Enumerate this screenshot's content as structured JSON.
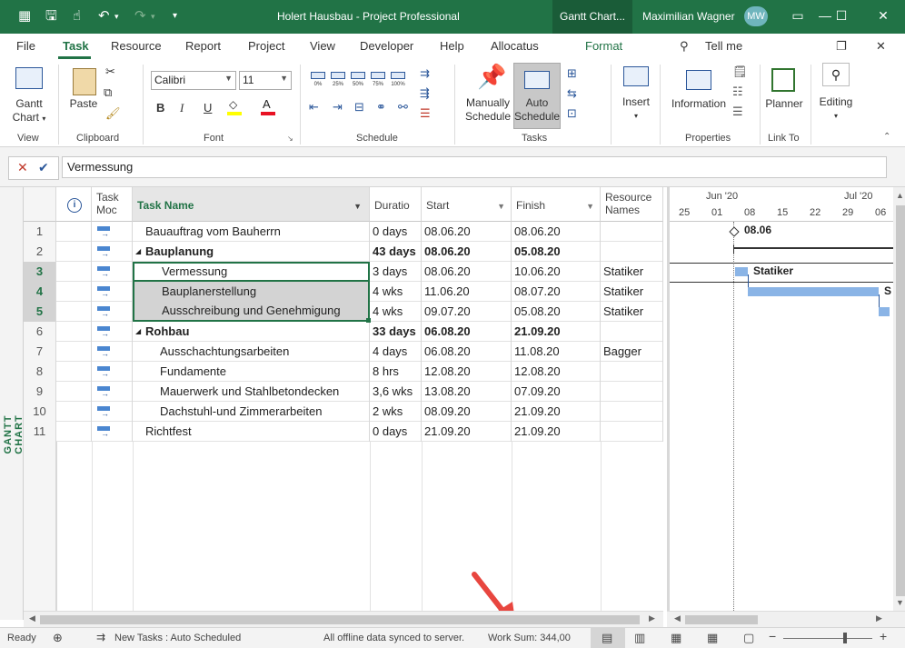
{
  "window": {
    "title": "Holert Hausbau  -  Project Professional",
    "context_tab": "Gantt Chart...",
    "user": "Maximilian Wagner",
    "avatar_initials": "MW"
  },
  "menu": {
    "tabs": [
      "File",
      "Task",
      "Resource",
      "Report",
      "Project",
      "View",
      "Developer",
      "Help",
      "Allocatus",
      "Format"
    ],
    "active": "Task",
    "tell_me": "Tell me"
  },
  "ribbon": {
    "view": {
      "group": "View",
      "gantt_chart": "Gantt\nChart",
      "gantt_line1": "Gantt",
      "gantt_line2": "Chart"
    },
    "clipboard": {
      "group": "Clipboard",
      "paste": "Paste"
    },
    "font": {
      "group": "Font",
      "family": "Calibri",
      "size": "11",
      "bold": "B",
      "italic": "I",
      "underline": "U"
    },
    "schedule": {
      "group": "Schedule",
      "pct": [
        "0%",
        "25%",
        "50%",
        "75%",
        "100%"
      ]
    },
    "tasks": {
      "group": "Tasks",
      "manually": "Manually",
      "manually2": "Schedule",
      "auto": "Auto",
      "auto2": "Schedule",
      "insert": "Insert"
    },
    "properties": {
      "group": "Properties",
      "information": "Information"
    },
    "linkto": {
      "group": "Link To",
      "planner": "Planner"
    },
    "editing": {
      "label": "Editing"
    }
  },
  "formula": {
    "value": "Vermessung"
  },
  "side_label": "GANTT CHART",
  "columns": {
    "info": "i",
    "task_mode": [
      "Task",
      "Moc"
    ],
    "task_name": "Task Name",
    "duration": "Duratio",
    "start": "Start",
    "finish": "Finish",
    "resource": [
      "Resource",
      "Names"
    ]
  },
  "rows": [
    {
      "id": "1",
      "name": "Bauauftrag vom Bauherrn",
      "indent": 1,
      "summary": false,
      "duration": "0 days",
      "start": "08.06.20",
      "finish": "08.06.20",
      "resource": "",
      "selected": false
    },
    {
      "id": "2",
      "name": "Bauplanung",
      "indent": 1,
      "summary": true,
      "duration": "43 days",
      "start": "08.06.20",
      "finish": "05.08.20",
      "resource": "",
      "selected": false
    },
    {
      "id": "3",
      "name": "Vermessung",
      "indent": 2,
      "summary": false,
      "duration": "3 days",
      "start": "08.06.20",
      "finish": "10.06.20",
      "resource": "Statiker",
      "selected": "active"
    },
    {
      "id": "4",
      "name": "Bauplanerstellung",
      "indent": 2,
      "summary": false,
      "duration": "4 wks",
      "start": "11.06.20",
      "finish": "08.07.20",
      "resource": "Statiker",
      "selected": true
    },
    {
      "id": "5",
      "name": "Ausschreibung und Genehmigung",
      "indent": 2,
      "summary": false,
      "duration": "4 wks",
      "start": "09.07.20",
      "finish": "05.08.20",
      "resource": "Statiker",
      "selected": true
    },
    {
      "id": "6",
      "name": "Rohbau",
      "indent": 1,
      "summary": true,
      "duration": "33 days",
      "start": "06.08.20",
      "finish": "21.09.20",
      "resource": "",
      "selected": false
    },
    {
      "id": "7",
      "name": "Ausschachtungsarbeiten",
      "indent": 2,
      "summary": false,
      "duration": "4 days",
      "start": "06.08.20",
      "finish": "11.08.20",
      "resource": "Bagger",
      "selected": false
    },
    {
      "id": "8",
      "name": "Fundamente",
      "indent": 2,
      "summary": false,
      "duration": "8 hrs",
      "start": "12.08.20",
      "finish": "12.08.20",
      "resource": "",
      "selected": false
    },
    {
      "id": "9",
      "name": "Mauerwerk und Stahlbetondecken",
      "indent": 2,
      "summary": false,
      "duration": "3,6 wks",
      "start": "13.08.20",
      "finish": "07.09.20",
      "resource": "",
      "selected": false
    },
    {
      "id": "10",
      "name": "Dachstuhl-und Zimmerarbeiten",
      "indent": 2,
      "summary": false,
      "duration": "2 wks",
      "start": "08.09.20",
      "finish": "21.09.20",
      "resource": "",
      "selected": false
    },
    {
      "id": "11",
      "name": "Richtfest",
      "indent": 1,
      "summary": false,
      "duration": "0 days",
      "start": "21.09.20",
      "finish": "21.09.20",
      "resource": "",
      "selected": false
    }
  ],
  "timeline": {
    "months": [
      "Jun '20",
      "Jul '20"
    ],
    "days": [
      "25",
      "01",
      "08",
      "15",
      "22",
      "29",
      "06"
    ],
    "milestone_label": "08.06",
    "bar_label": "Statiker",
    "bar2_label": "S"
  },
  "status": {
    "ready": "Ready",
    "new_tasks": "New Tasks : Auto Scheduled",
    "sync": "All offline data synced to server.",
    "work_sum": "Work Sum: 344,00"
  },
  "colors": {
    "accent": "#217346",
    "bar": "#8ab4e6",
    "selected": "#d3d3d3"
  }
}
